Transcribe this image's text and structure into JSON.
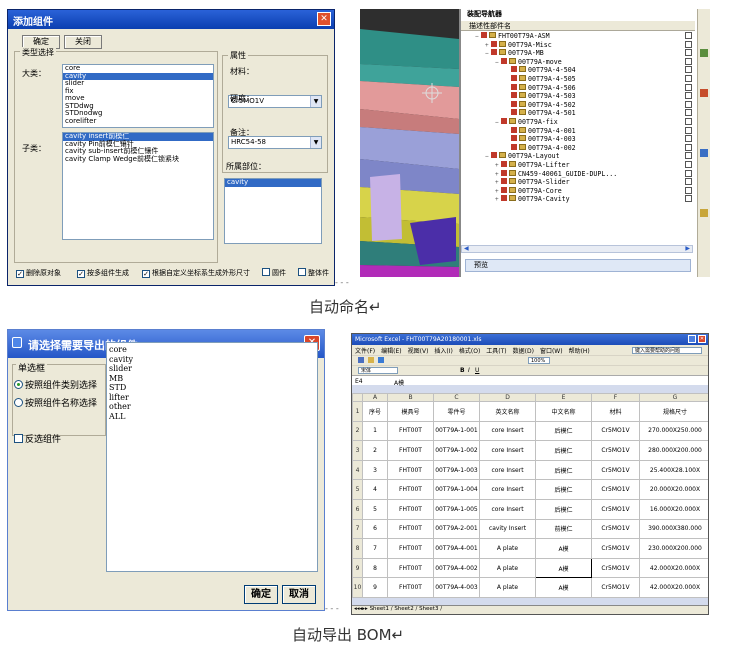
{
  "add_component_dialog": {
    "title": "添加组件",
    "ok_label": "确定",
    "close_label": "关闭",
    "type_select_label": "类型选择",
    "category_label": "大类：",
    "category_items": [
      "core",
      "cavity",
      "slider",
      "fix",
      "move",
      "STDdwg",
      "STDnodwg",
      "corelifter"
    ],
    "category_selected": "cavity",
    "subcategory_label": "子类：",
    "subcategory_items": [
      "cavity insert前模仁",
      "cavity Pin前模仁镶针",
      "cavity sub-insert前模仁镶件",
      "cavity Clamp Wedge前模仁锁紧块"
    ],
    "subcategory_selected": "cavity insert前模仁",
    "attr_label": "属性",
    "material_label": "材料：",
    "material_value": "Cr5MO1V",
    "hardness_label": "硬度：",
    "hardness_value": "HRC54-58",
    "spare_label": "备注：",
    "spare_value": "1",
    "location_label": "所属部位：",
    "location_value": "cavity",
    "footer_checks": [
      {
        "label": "删除原对象",
        "checked": true
      },
      {
        "label": "按多组件生成",
        "checked": true
      },
      {
        "label": "根据自定义坐标系生成外形尺寸",
        "checked": true
      },
      {
        "label": "圆件",
        "checked": false
      },
      {
        "label": "整体件",
        "checked": false
      }
    ]
  },
  "assembly_navigator": {
    "title": "装配导航器",
    "col_name": "描述性部件名",
    "rows": [
      {
        "text": "FHT00T79A-ASM",
        "indent": 0,
        "exp": "−"
      },
      {
        "text": "00T79A-Misc",
        "indent": 1,
        "exp": "+"
      },
      {
        "text": "00T79A-MB",
        "indent": 1,
        "exp": "−"
      },
      {
        "text": "00T79A-move",
        "indent": 2,
        "exp": "−"
      },
      {
        "text": "00T79A-4-504",
        "indent": 3,
        "exp": ""
      },
      {
        "text": "00T79A-4-505",
        "indent": 3,
        "exp": ""
      },
      {
        "text": "00T79A-4-506",
        "indent": 3,
        "exp": ""
      },
      {
        "text": "00T79A-4-503",
        "indent": 3,
        "exp": ""
      },
      {
        "text": "00T79A-4-502",
        "indent": 3,
        "exp": ""
      },
      {
        "text": "00T79A-4-501",
        "indent": 3,
        "exp": ""
      },
      {
        "text": "00T79A-fix",
        "indent": 2,
        "exp": "−"
      },
      {
        "text": "00T79A-4-001",
        "indent": 3,
        "exp": ""
      },
      {
        "text": "00T79A-4-003",
        "indent": 3,
        "exp": ""
      },
      {
        "text": "00T79A-4-002",
        "indent": 3,
        "exp": ""
      },
      {
        "text": "00T79A-Layout",
        "indent": 1,
        "exp": "−"
      },
      {
        "text": "00T79A-Lifter",
        "indent": 2,
        "exp": "+"
      },
      {
        "text": "CN459-40061_GUIDE-DUPL...",
        "indent": 2,
        "exp": "+"
      },
      {
        "text": "00T79A-Slider",
        "indent": 2,
        "exp": "+"
      },
      {
        "text": "00T79A-Core",
        "indent": 2,
        "exp": "+"
      },
      {
        "text": "00T79A-Cavity",
        "indent": 2,
        "exp": "+"
      }
    ],
    "preview_label": "预览"
  },
  "caption_top": "自动命名↵",
  "export_dialog": {
    "title": "请选择需要导出的组件",
    "single_select_label": "单选框",
    "radio_by_type": "按照组件类别选择",
    "radio_by_name": "按照组件名称选择",
    "reverse_label": "反选组件",
    "list_items": [
      "core",
      "cavity",
      "slider",
      "MB",
      "STD",
      "lifter",
      "other",
      "ALL"
    ],
    "ok_label": "确定",
    "cancel_label": "取消"
  },
  "excel": {
    "title": "Microsoft Excel - FHT00T79A20180001.xls",
    "menu_items": [
      "文件(F)",
      "编辑(E)",
      "视图(V)",
      "插入(I)",
      "格式(O)",
      "工具(T)",
      "数据(D)",
      "窗口(W)",
      "帮助(H)"
    ],
    "help_box": "键入需要帮助的问题",
    "zoom": "100%",
    "font": "宋体",
    "cell_ref": "E4",
    "formula": "A模",
    "col_letters": [
      "A",
      "B",
      "C",
      "D",
      "E",
      "F",
      "G"
    ],
    "headers": [
      "序号",
      "模具号",
      "零件号",
      "英文名称",
      "中文名称",
      "材料",
      "规格尺寸"
    ],
    "rows": [
      [
        "1",
        "FHT00T",
        "00T79A-1-001",
        "core Insert",
        "后模仁",
        "Cr5MO1V",
        "270.000X250.000"
      ],
      [
        "2",
        "FHT00T",
        "00T79A-1-002",
        "core Insert",
        "后模仁",
        "Cr5MO1V",
        "280.000X200.000"
      ],
      [
        "3",
        "FHT00T",
        "00T79A-1-003",
        "core Insert",
        "后模仁",
        "Cr5MO1V",
        "25.400X28.100X"
      ],
      [
        "4",
        "FHT00T",
        "00T79A-1-004",
        "core Insert",
        "后模仁",
        "Cr5MO1V",
        "20.000X20.000X"
      ],
      [
        "5",
        "FHT00T",
        "00T79A-1-005",
        "core Insert",
        "后模仁",
        "Cr5MO1V",
        "16.000X20.000X"
      ],
      [
        "6",
        "FHT00T",
        "00T79A-2-001",
        "cavity Insert",
        "前模仁",
        "Cr5MO1V",
        "390.000X380.000"
      ],
      [
        "7",
        "FHT00T",
        "00T79A-4-001",
        "A plate",
        "A模",
        "Cr5MO1V",
        "230.000X200.000"
      ],
      [
        "8",
        "FHT00T",
        "00T79A-4-002",
        "A plate",
        "A模",
        "Cr5MO1V",
        "42.000X20.000X"
      ],
      [
        "9",
        "FHT00T",
        "00T79A-4-003",
        "A plate",
        "A模",
        "Cr5MO1V",
        "42.000X20.000X"
      ]
    ],
    "row_numbers": [
      "1",
      "2",
      "3",
      "4",
      "5",
      "6",
      "7",
      "8",
      "9",
      "10"
    ],
    "sheet_tabs": "Sheet1 / Sheet2 / Sheet3 /"
  },
  "caption_bottom": "自动导出 BOM↵"
}
